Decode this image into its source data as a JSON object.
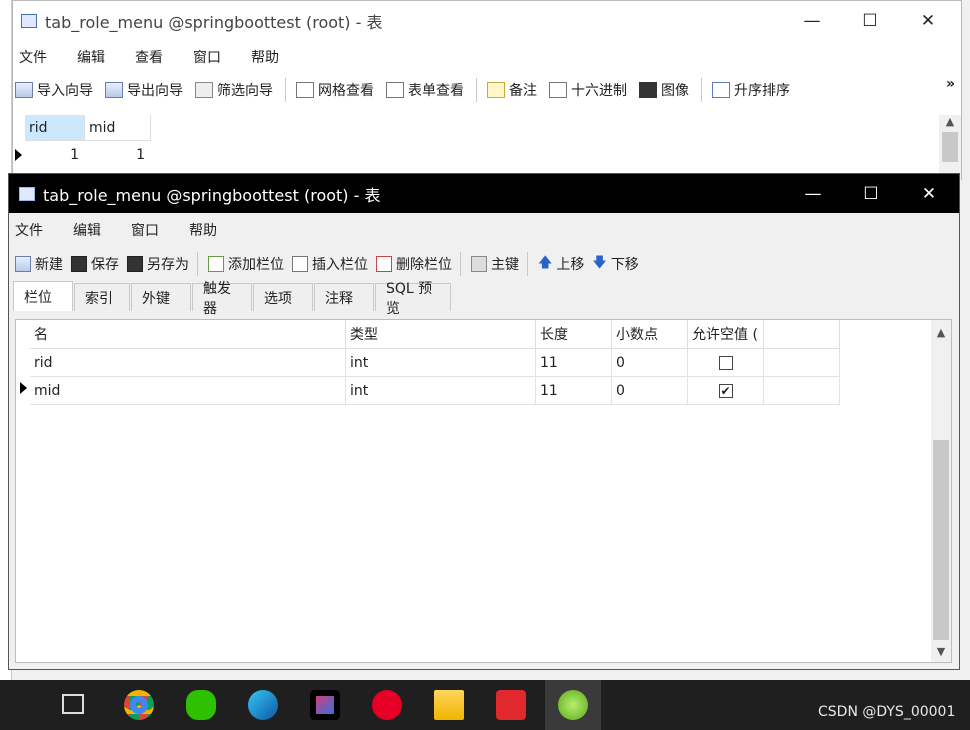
{
  "window_back": {
    "title": "tab_role_menu @springboottest (root) - 表",
    "menu": [
      "文件",
      "编辑",
      "查看",
      "窗口",
      "帮助"
    ],
    "toolbar": [
      "导入向导",
      "导出向导",
      "筛选向导",
      "网格查看",
      "表单查看",
      "备注",
      "十六进制",
      "图像",
      "升序排序"
    ],
    "overflow": "»",
    "grid": {
      "headers": [
        "rid",
        "mid"
      ],
      "rows": [
        [
          "1",
          "1"
        ]
      ]
    }
  },
  "window_front": {
    "title": "tab_role_menu @springboottest (root) - 表",
    "menu": [
      "文件",
      "编辑",
      "窗口",
      "帮助"
    ],
    "toolbar": [
      "新建",
      "保存",
      "另存为",
      "添加栏位",
      "插入栏位",
      "删除栏位",
      "主键",
      "上移",
      "下移"
    ],
    "tabs": [
      "栏位",
      "索引",
      "外键",
      "触发器",
      "选项",
      "注释",
      "SQL 预览"
    ],
    "columns_table": {
      "headers": [
        "名",
        "类型",
        "长度",
        "小数点",
        "允许空值 (",
        ""
      ],
      "rows": [
        {
          "name": "rid",
          "type": "int",
          "length": "11",
          "decimals": "0",
          "nullable": false
        },
        {
          "name": "mid",
          "type": "int",
          "length": "11",
          "decimals": "0",
          "nullable": true
        }
      ]
    }
  },
  "window_controls": {
    "minimize": "—",
    "maximize": "☐",
    "close": "✕"
  },
  "taskbar": {
    "watermark": "CSDN @DYS_00001",
    "icons": [
      "task-view-icon",
      "chrome-icon",
      "wechat-icon",
      "edge-icon",
      "jetbrains-icon",
      "netease-music-icon",
      "file-explorer-icon",
      "wps-icon",
      "navicat-icon"
    ]
  },
  "colors": {
    "taskbar": "#1f1f1f",
    "front_titlebar": "#000000",
    "selection": "#cce8ff"
  }
}
